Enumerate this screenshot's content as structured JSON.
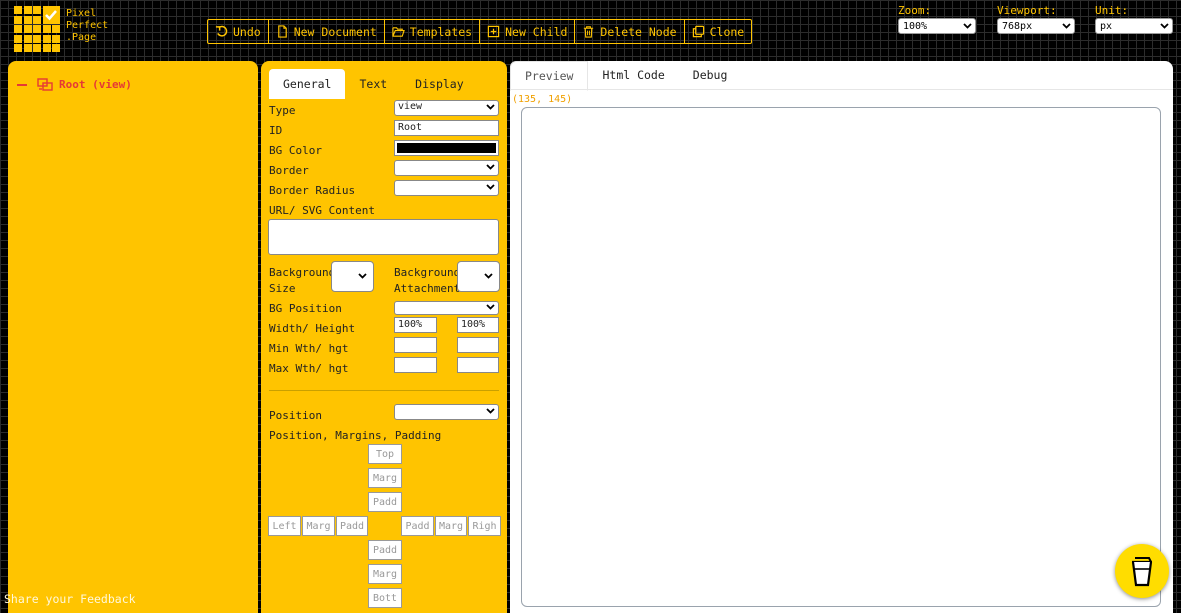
{
  "logo": {
    "line1": "Pixel",
    "line2": "Perfect",
    "line3": ".Page"
  },
  "toolbar": {
    "undo": "Undo",
    "new_document": "New Document",
    "templates": "Templates",
    "new_child": "New Child",
    "delete_node": "Delete Node",
    "clone": "Clone"
  },
  "header": {
    "zoom_label": "Zoom:",
    "zoom_value": "100%",
    "viewport_label": "Viewport:",
    "viewport_value": "768px",
    "unit_label": "Unit:",
    "unit_value": "px"
  },
  "tree": {
    "root_label": "Root (view)"
  },
  "feedback": "Share your Feedback",
  "properties": {
    "tabs": [
      "General",
      "Text",
      "Display"
    ],
    "type_label": "Type",
    "type_value": "view",
    "id_label": "ID",
    "id_value": "Root",
    "bg_color_label": "BG Color",
    "bg_color_value": "#000000",
    "border_label": "Border",
    "border_radius_label": "Border Radius",
    "url_label": "URL/ SVG Content",
    "bg_size_label_1": "Background",
    "bg_size_label_2": "Size",
    "bg_attach_label_1": "Background",
    "bg_attach_label_2": "Attachment",
    "bg_position_label": "BG Position",
    "width_height_label": "Width/ Height",
    "width_value": "100%",
    "height_value": "100%",
    "min_label": "Min Wth/ hgt",
    "max_label": "Max Wth/ hgt",
    "position_label": "Position",
    "pmp_label": "Position, Margins, Padding",
    "box": {
      "top": "Top",
      "margin": "Marg",
      "padding": "Padd",
      "left": "Left",
      "right": "Righ",
      "bottom": "Bott"
    }
  },
  "preview": {
    "tabs": [
      "Preview",
      "Html Code",
      "Debug"
    ],
    "coords": "(135, 145)"
  },
  "colors": {
    "accent": "#ffc400",
    "tree_text": "#e53935",
    "coords": "#f0a000"
  }
}
